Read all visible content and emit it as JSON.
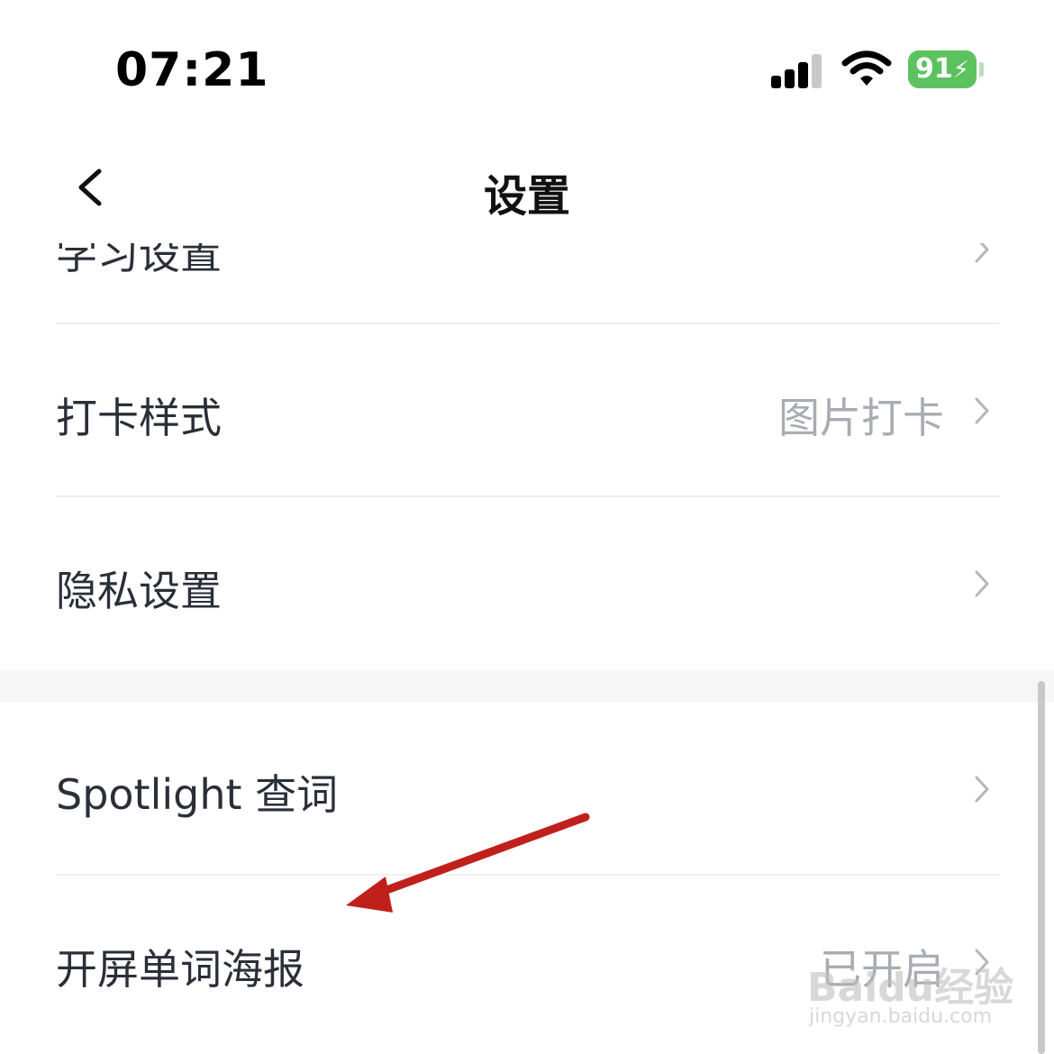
{
  "status_bar": {
    "time": "07:21",
    "battery": "91",
    "icons": [
      "signal-icon",
      "wifi-icon",
      "battery-charging-icon"
    ]
  },
  "nav": {
    "title": "设置",
    "back_icon": "chevron-left-icon"
  },
  "rows": [
    {
      "label": "学习设置",
      "value": ""
    },
    {
      "label": "打卡样式",
      "value": "图片打卡"
    },
    {
      "label": "隐私设置",
      "value": ""
    },
    {
      "label": "Spotlight 查词",
      "value": ""
    },
    {
      "label": "开屏单词海报",
      "value": "已开启"
    }
  ],
  "colors": {
    "annotation_arrow": "#c0201c",
    "battery": "#5cc25f",
    "section_gap": "#f6f6f6"
  },
  "watermark": {
    "main": "Baidu经验",
    "sub": "jingyan.baidu.com"
  }
}
